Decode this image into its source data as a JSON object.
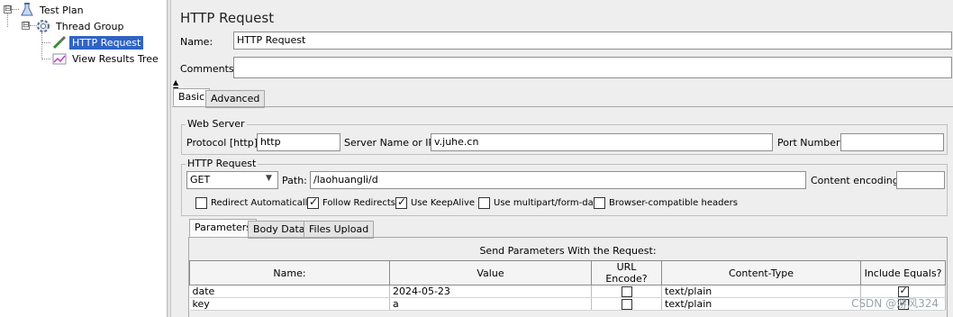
{
  "tree": {
    "items": [
      {
        "label": "Test Plan",
        "icon": "flask-icon"
      },
      {
        "label": "Thread Group",
        "icon": "gear-icon"
      },
      {
        "label": "HTTP Request",
        "icon": "pipette-icon",
        "selected": true
      },
      {
        "label": "View Results Tree",
        "icon": "chart-icon"
      }
    ],
    "expanded_symbol": "⊟"
  },
  "panel": {
    "title": "HTTP Request",
    "name_label": "Name:",
    "name_value": "HTTP Request",
    "comments_label": "Comments:",
    "comments_value": "",
    "tabs": [
      {
        "label": "Basic"
      },
      {
        "label": "Advanced"
      }
    ]
  },
  "web_server": {
    "group_title": "Web Server",
    "protocol_label": "Protocol [http]:",
    "protocol_value": "http",
    "server_label": "Server Name or IP:",
    "server_value": "v.juhe.cn",
    "port_label": "Port Number:",
    "port_value": ""
  },
  "http_request": {
    "group_title": "HTTP Request",
    "method": "GET",
    "path_label": "Path:",
    "path_value": "/laohuangli/d",
    "encoding_label": "Content encoding:",
    "encoding_value": "",
    "options": [
      {
        "label": "Redirect Automatically",
        "checked": false
      },
      {
        "label": "Follow Redirects",
        "checked": true
      },
      {
        "label": "Use KeepAlive",
        "checked": true
      },
      {
        "label": "Use multipart/form-data",
        "checked": false
      },
      {
        "label": "Browser-compatible headers",
        "checked": false
      }
    ]
  },
  "params": {
    "tabs": [
      {
        "label": "Parameters"
      },
      {
        "label": "Body Data"
      },
      {
        "label": "Files Upload"
      }
    ],
    "table_title": "Send Parameters With the Request:",
    "columns": [
      "Name:",
      "Value",
      "URL Encode?",
      "Content-Type",
      "Include Equals?"
    ],
    "rows": [
      {
        "name": "date",
        "value": "2024-05-23",
        "url_encode": false,
        "content_type": "text/plain",
        "include_equals": true
      },
      {
        "name": "key",
        "value": "a",
        "url_encode": false,
        "content_type": "text/plain",
        "include_equals": true
      }
    ]
  },
  "watermark": "CSDN @游风324",
  "colors": {
    "selection": "#2f63c5",
    "background": "#eeeeee"
  }
}
